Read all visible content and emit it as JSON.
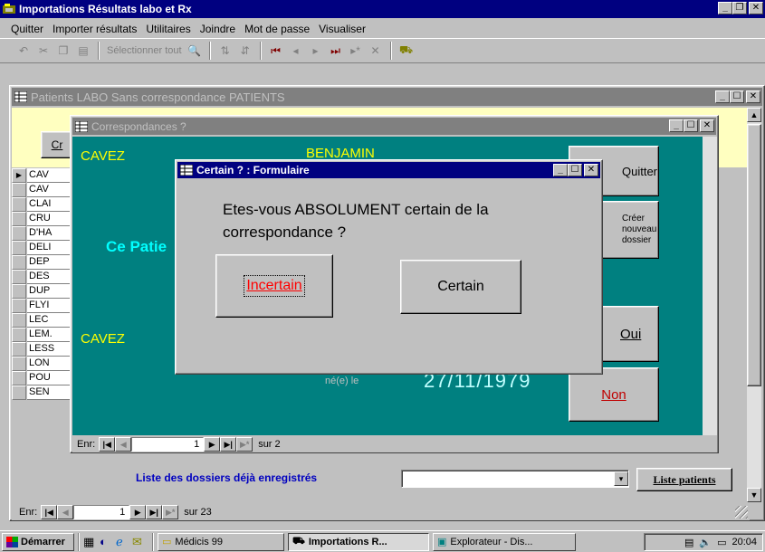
{
  "app": {
    "title": "Importations Résultats labo et Rx"
  },
  "menu": [
    {
      "label": "Quitter"
    },
    {
      "label": "Importer résultats"
    },
    {
      "label": "Utilitaires"
    },
    {
      "label": "Joindre"
    },
    {
      "label": "Mot de passe"
    },
    {
      "label": "Visualiser"
    }
  ],
  "toolbar": {
    "select_all_label": "Sélectionner tout"
  },
  "patients_window": {
    "title": "Patients LABO Sans correspondance PATIENTS",
    "header_button_label": "Cr",
    "list_items": [
      "CAV",
      "CAV",
      "CLAI",
      "CRU",
      "D'HA",
      "DELI",
      "DEP",
      "DES",
      "DUP",
      "FLYI",
      "LEC",
      "LEM.",
      "LESS",
      "LON",
      "POU",
      "SEN"
    ],
    "dossiers_label": "Liste des dossiers déjà enregistrés",
    "dossiers_select_value": "",
    "liste_patients_label": "Liste patients",
    "record_nav": {
      "prefix": "Enr:",
      "current": "1",
      "of": "sur 23"
    }
  },
  "correspondances_window": {
    "title": "Correspondances ?",
    "labo_name": "CAVEZ",
    "labo_firstname": "BENJAMIN",
    "patient_label_partial": "Ce Patie",
    "patient_name": "CAVEZ",
    "born_label": "né(e) le",
    "birth_date": "27/11/1979",
    "quit_button_label": "Quitter",
    "new_file_button_label": "Créer nouveau dossier",
    "yes_label": "Oui",
    "no_label": "Non",
    "record_nav": {
      "prefix": "Enr:",
      "current": "1",
      "of": "sur 2"
    }
  },
  "dialog": {
    "title": "Certain ? : Formulaire",
    "question": "Etes-vous ABSOLUMENT certain de la correspondance ?",
    "uncertain_label": "Incertain",
    "certain_label": "Certain"
  },
  "taskbar": {
    "start_label": "Démarrer",
    "tasks": [
      {
        "label": "Médicis 99"
      },
      {
        "label": "Importations R..."
      },
      {
        "label": "Explorateur - Dis..."
      }
    ],
    "clock": "20:04"
  },
  "colors": {
    "form_teal": "#008080",
    "header_yellow": "#ffffc0",
    "title_active": "#000080",
    "title_inactive": "#808080",
    "name_yellow": "#ffff00",
    "patient_cyan": "#00ffff",
    "dossiers_blue": "#0000c0",
    "uncertain_red": "#ff0000"
  }
}
